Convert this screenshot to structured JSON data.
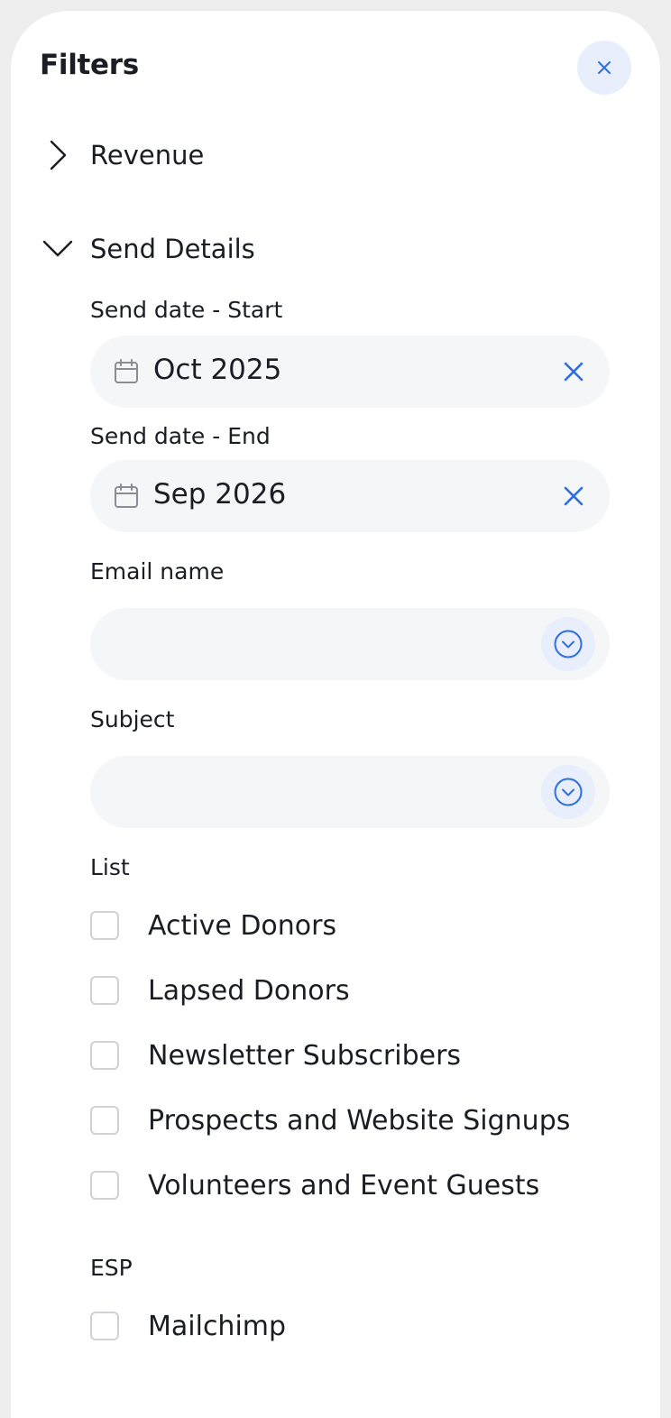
{
  "header": {
    "title": "Filters",
    "close_icon": "close-icon"
  },
  "sections": {
    "revenue": {
      "label": "Revenue",
      "state": "collapsed"
    },
    "send_details": {
      "label": "Send Details",
      "state": "expanded"
    }
  },
  "send_date_start": {
    "label": "Send date - Start",
    "value": "Oct 2025"
  },
  "send_date_end": {
    "label": "Send date - End",
    "value": "Sep 2026"
  },
  "email_name": {
    "label": "Email name",
    "value": ""
  },
  "subject": {
    "label": "Subject",
    "value": ""
  },
  "list": {
    "label": "List",
    "options": [
      {
        "label": "Active Donors",
        "checked": false
      },
      {
        "label": "Lapsed Donors",
        "checked": false
      },
      {
        "label": "Newsletter Subscribers",
        "checked": false
      },
      {
        "label": "Prospects and Website Signups",
        "checked": false
      },
      {
        "label": "Volunteers and Event Guests",
        "checked": false
      }
    ]
  },
  "esp": {
    "label": "ESP",
    "options": [
      {
        "label": "Mailchimp",
        "checked": false
      }
    ]
  },
  "colors": {
    "accent": "#2f6fe0",
    "accent_bg": "#e8eefb",
    "field_bg": "#f5f6f8"
  }
}
